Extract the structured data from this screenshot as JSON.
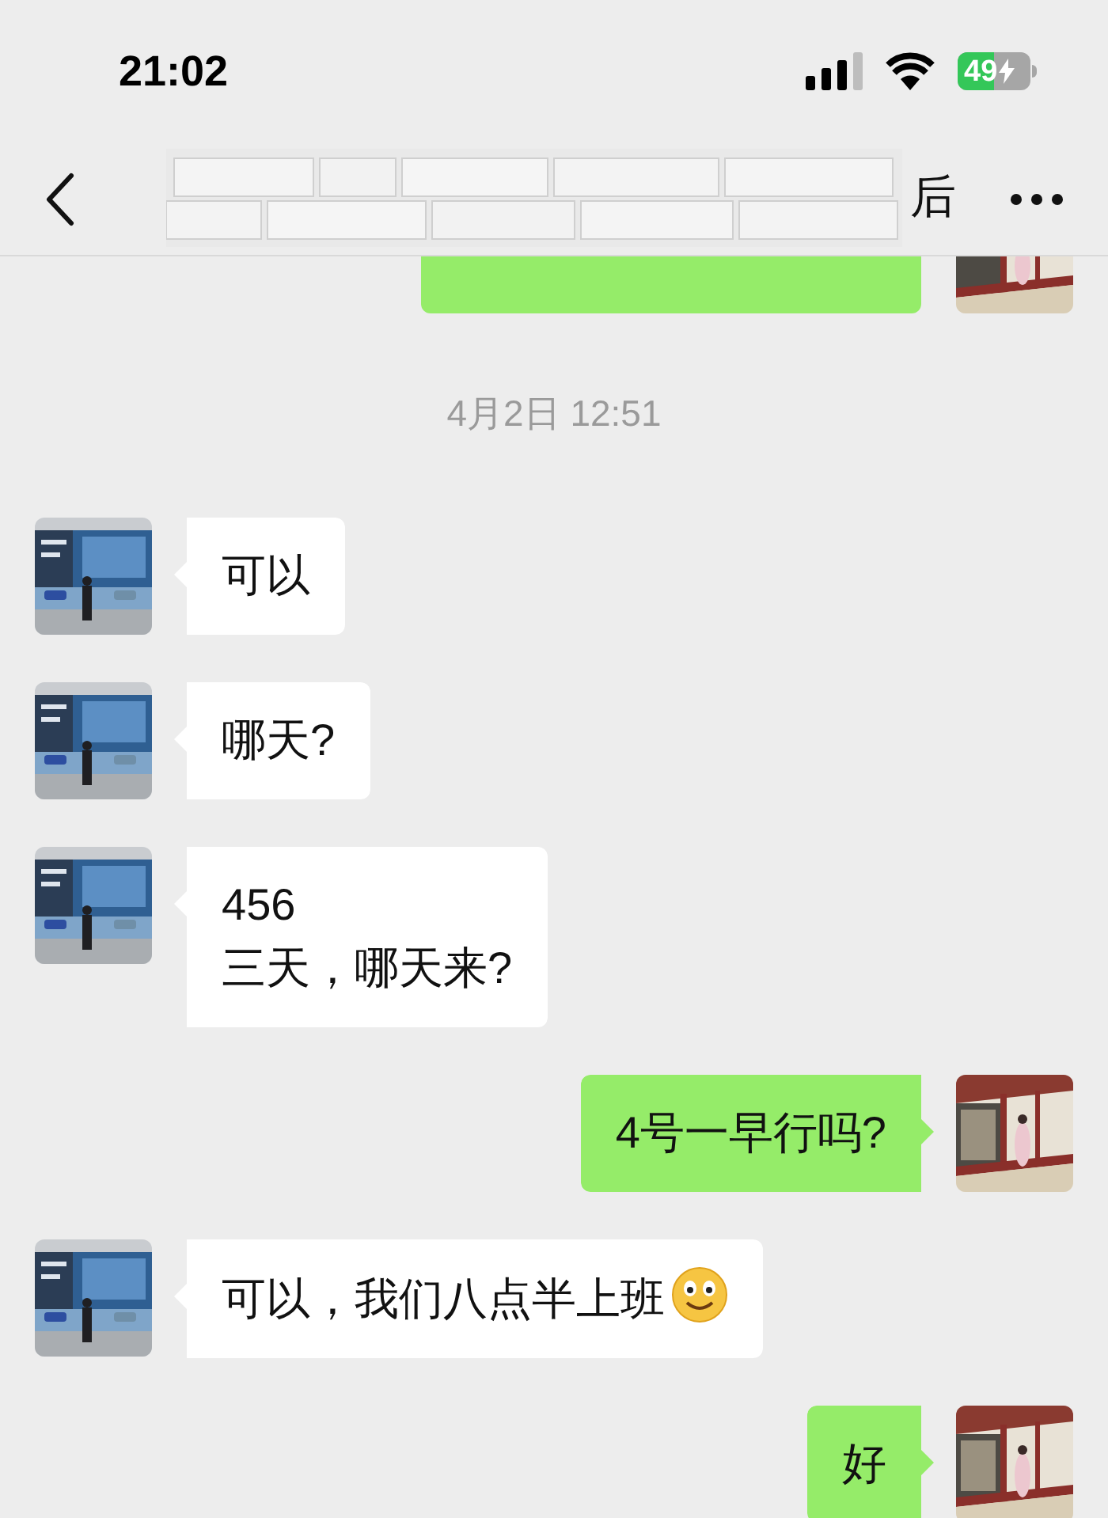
{
  "status_bar": {
    "time": "21:02",
    "battery": "49"
  },
  "header": {
    "title": "后"
  },
  "messages": [
    {
      "kind": "sent_cut"
    },
    {
      "kind": "timestamp",
      "text": "4月2日 12:51"
    },
    {
      "kind": "received",
      "text": "可以"
    },
    {
      "kind": "received",
      "text": "哪天?"
    },
    {
      "kind": "received",
      "text": "456\n三天，哪天来?"
    },
    {
      "kind": "sent",
      "text": "4号一早行吗?"
    },
    {
      "kind": "received",
      "text": "可以，我们八点半上班",
      "smiley": true
    },
    {
      "kind": "sent",
      "text": "好"
    }
  ]
}
